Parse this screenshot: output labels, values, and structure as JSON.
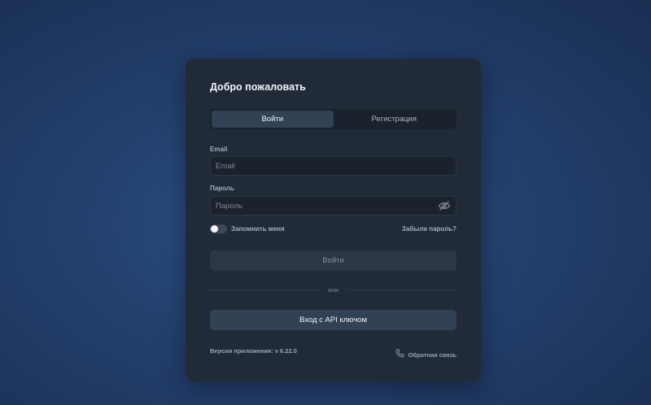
{
  "login": {
    "title": "Добро пожаловать",
    "tabs": [
      {
        "label": "Войти",
        "active": true
      },
      {
        "label": "Регистрация",
        "active": false
      }
    ],
    "email": {
      "label": "Email",
      "value": "",
      "placeholder": "Email"
    },
    "password": {
      "label": "Пароль",
      "value": "",
      "placeholder": "Пароль",
      "icon": "eye-off-icon"
    },
    "remember": {
      "label": "Запомнить меня",
      "checked": false
    },
    "forgot_label": "Забыли пароль?",
    "submit_label": "Войти",
    "divider_label": "или",
    "api_key_label": "Вход с API ключом",
    "version": "Версия приложения: v 6.22.0",
    "feedback": {
      "label": "Обратная связь",
      "icon": "phone-icon"
    }
  },
  "colors": {
    "background": "#223f6c",
    "card": "#212b38",
    "input_bg": "#1a222d",
    "accent_button": "#334155",
    "muted_text": "#a3aebb"
  }
}
